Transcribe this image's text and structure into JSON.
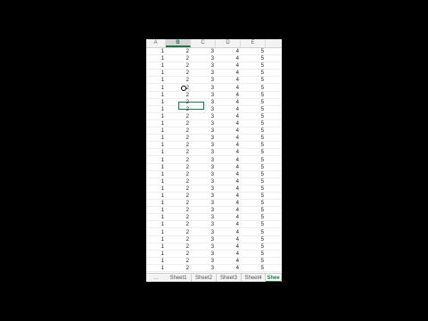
{
  "columns": [
    {
      "label": "A",
      "selected": false
    },
    {
      "label": "B",
      "selected": true
    },
    {
      "label": "C",
      "selected": false
    },
    {
      "label": "D",
      "selected": false
    },
    {
      "label": "E",
      "selected": false
    }
  ],
  "row_values": [
    "1",
    "2",
    "3",
    "4",
    "5"
  ],
  "row_count": 31,
  "tabs": {
    "nav": "...",
    "items": [
      {
        "label": "Sheet1",
        "active": false
      },
      {
        "label": "Sheet2",
        "active": false
      },
      {
        "label": "Sheet3",
        "active": false
      },
      {
        "label": "Sheet4",
        "active": false
      },
      {
        "label": "Shee",
        "active": true
      }
    ]
  },
  "colors": {
    "accent": "#217346",
    "background": "#000000",
    "sheet": "#ffffff"
  }
}
